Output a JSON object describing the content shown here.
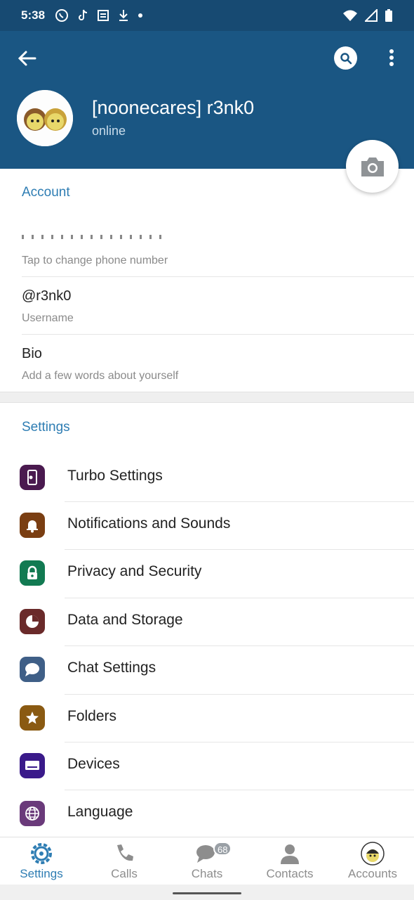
{
  "status_bar": {
    "time": "5:38"
  },
  "profile": {
    "name": "[noonecares] r3nk0",
    "status": "online"
  },
  "account": {
    "title": "Account",
    "phone_hint": "Tap to change phone number",
    "username": "@r3nk0",
    "username_label": "Username",
    "bio": "Bio",
    "bio_hint": "Add a few words about yourself"
  },
  "settings": {
    "title": "Settings",
    "items": [
      {
        "label": "Turbo Settings",
        "icon": "turbo-settings-icon",
        "color": "#4a1a4f"
      },
      {
        "label": "Notifications and Sounds",
        "icon": "bell-icon",
        "color": "#7a3e12"
      },
      {
        "label": "Privacy and Security",
        "icon": "lock-icon",
        "color": "#127a52"
      },
      {
        "label": "Data and Storage",
        "icon": "pie-chart-icon",
        "color": "#6a2a2a"
      },
      {
        "label": "Chat Settings",
        "icon": "chat-bubble-icon",
        "color": "#3f5f87"
      },
      {
        "label": "Folders",
        "icon": "star-icon",
        "color": "#8a5a12"
      },
      {
        "label": "Devices",
        "icon": "monitor-icon",
        "color": "#3a1a8a"
      },
      {
        "label": "Language",
        "icon": "globe-icon",
        "color": "#6a3a7a"
      }
    ]
  },
  "bottom_nav": {
    "tabs": [
      {
        "label": "Settings",
        "icon": "gear-icon",
        "active": true
      },
      {
        "label": "Calls",
        "icon": "phone-icon"
      },
      {
        "label": "Chats",
        "icon": "chats-icon",
        "badge": "68"
      },
      {
        "label": "Contacts",
        "icon": "person-icon"
      },
      {
        "label": "Accounts",
        "icon": "account-avatar-icon"
      }
    ]
  },
  "colors": {
    "header": "#1a5683",
    "accent": "#2e7db3"
  }
}
